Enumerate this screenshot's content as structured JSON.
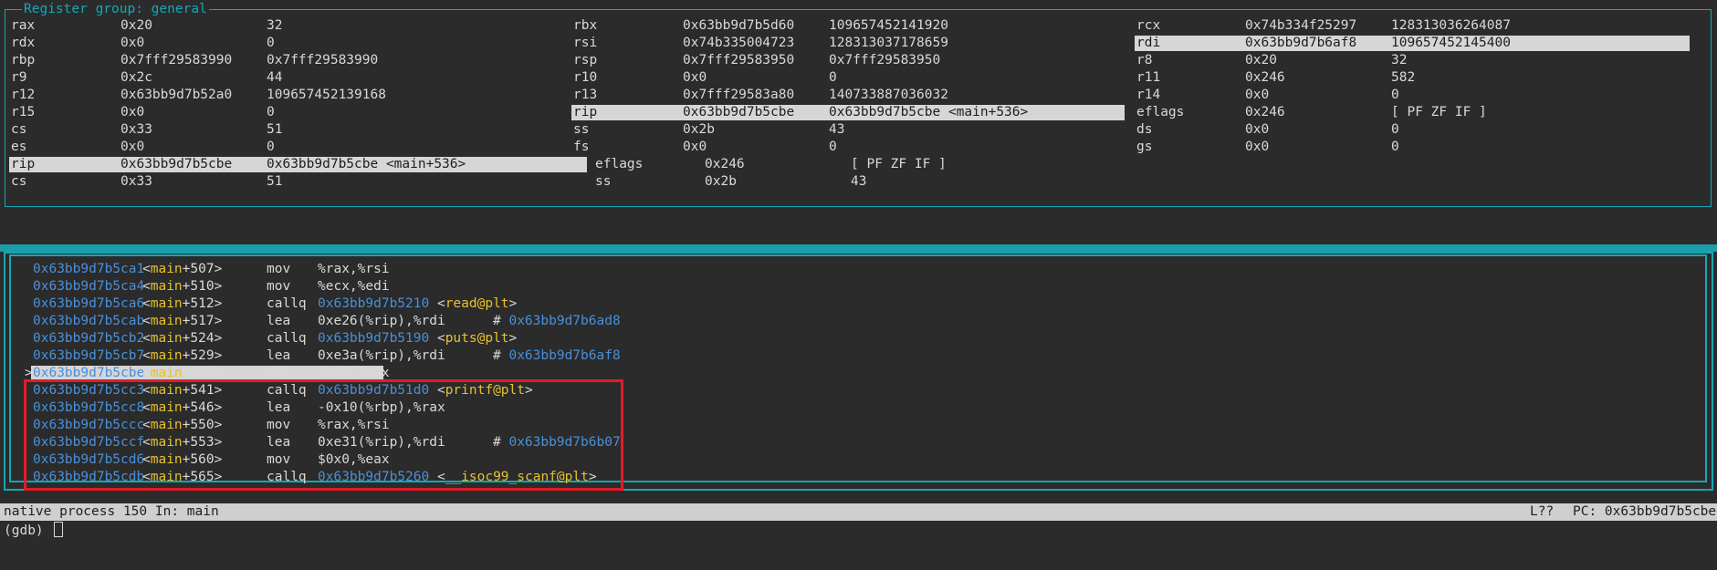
{
  "reg": {
    "title": "Register group: general",
    "rows": [
      [
        [
          "rax",
          "0x20",
          "32"
        ],
        [
          "rbx",
          "0x63bb9d7b5d60",
          "109657452141920"
        ],
        [
          "rcx",
          "0x74b334f25297",
          "128313036264087"
        ]
      ],
      [
        [
          "rdx",
          "0x0",
          "0"
        ],
        [
          "rsi",
          "0x74b335004723",
          "128313037178659"
        ],
        [
          "rdi",
          "0x63bb9d7b6af8",
          "109657452145400"
        ]
      ],
      [
        [
          "rbp",
          "0x7fff29583990",
          "0x7fff29583990"
        ],
        [
          "rsp",
          "0x7fff29583950",
          "0x7fff29583950"
        ],
        [
          "r8",
          "0x20",
          "32"
        ]
      ],
      [
        [
          "r9",
          "0x2c",
          "44"
        ],
        [
          "r10",
          "0x0",
          "0"
        ],
        [
          "r11",
          "0x246",
          "582"
        ]
      ],
      [
        [
          "r12",
          "0x63bb9d7b52a0",
          "109657452139168"
        ],
        [
          "r13",
          "0x7fff29583a80",
          "140733887036032"
        ],
        [
          "r14",
          "0x0",
          "0"
        ]
      ],
      [
        [
          "r15",
          "0x0",
          "0"
        ],
        [
          "rip",
          "0x63bb9d7b5cbe",
          "0x63bb9d7b5cbe <main+536>"
        ],
        [
          "eflags",
          "0x246",
          "[ PF ZF IF ]"
        ]
      ],
      [
        [
          "cs",
          "0x33",
          "51"
        ],
        [
          "ss",
          "0x2b",
          "43"
        ],
        [
          "ds",
          "0x0",
          "0"
        ]
      ],
      [
        [
          "es",
          "0x0",
          "0"
        ],
        [
          "fs",
          "0x0",
          "0"
        ],
        [
          "gs",
          "0x0",
          "0"
        ]
      ]
    ],
    "extra": [
      [
        [
          "rip",
          "0x63bb9d7b5cbe",
          "0x63bb9d7b5cbe <main+536>"
        ],
        [
          "eflags",
          "0x246",
          "[ PF ZF IF ]"
        ]
      ],
      [
        [
          "cs",
          "0x33",
          "51"
        ],
        [
          "ss",
          "0x2b",
          "43"
        ]
      ]
    ]
  },
  "asm": [
    {
      "addr": "0x63bb9d7b5ca1",
      "sym": "main",
      "off": "+507",
      "op": "mov",
      "args": "%rax,%rsi"
    },
    {
      "addr": "0x63bb9d7b5ca4",
      "sym": "main",
      "off": "+510",
      "op": "mov",
      "args": "%ecx,%edi"
    },
    {
      "addr": "0x63bb9d7b5ca6",
      "sym": "main",
      "off": "+512",
      "op": "callq",
      "args_addr": "0x63bb9d7b5210",
      "args_sym": "read@plt"
    },
    {
      "addr": "0x63bb9d7b5cab",
      "sym": "main",
      "off": "+517",
      "op": "lea",
      "args": "0xe26(%rip),%rdi",
      "cmt": "0x63bb9d7b6ad8"
    },
    {
      "addr": "0x63bb9d7b5cb2",
      "sym": "main",
      "off": "+524",
      "op": "callq",
      "args_addr": "0x63bb9d7b5190",
      "args_sym": "puts@plt"
    },
    {
      "addr": "0x63bb9d7b5cb7",
      "sym": "main",
      "off": "+529",
      "op": "lea",
      "args": "0xe3a(%rip),%rdi",
      "cmt": "0x63bb9d7b6af8"
    },
    {
      "addr": "0x63bb9d7b5cbe",
      "sym": "main",
      "off": "+536",
      "op": "mov",
      "args": "$0x0,%eax",
      "current": true
    },
    {
      "addr": "0x63bb9d7b5cc3",
      "sym": "main",
      "off": "+541",
      "op": "callq",
      "args_addr": "0x63bb9d7b51d0",
      "args_sym": "printf@plt"
    },
    {
      "addr": "0x63bb9d7b5cc8",
      "sym": "main",
      "off": "+546",
      "op": "lea",
      "args": "-0x10(%rbp),%rax"
    },
    {
      "addr": "0x63bb9d7b5ccc",
      "sym": "main",
      "off": "+550",
      "op": "mov",
      "args": "%rax,%rsi"
    },
    {
      "addr": "0x63bb9d7b5ccf",
      "sym": "main",
      "off": "+553",
      "op": "lea",
      "args": "0xe31(%rip),%rdi",
      "cmt": "0x63bb9d7b6b07"
    },
    {
      "addr": "0x63bb9d7b5cd6",
      "sym": "main",
      "off": "+560",
      "op": "mov",
      "args": "$0x0,%eax"
    },
    {
      "addr": "0x63bb9d7b5cdb",
      "sym": "main",
      "off": "+565",
      "op": "callq",
      "args_addr": "0x63bb9d7b5260",
      "args_sym": "__isoc99_scanf@plt"
    }
  ],
  "status": {
    "left": "native process 150 In: main",
    "line": "L??",
    "pc": "PC: 0x63bb9d7b5cbe"
  },
  "prompt": "(gdb) "
}
